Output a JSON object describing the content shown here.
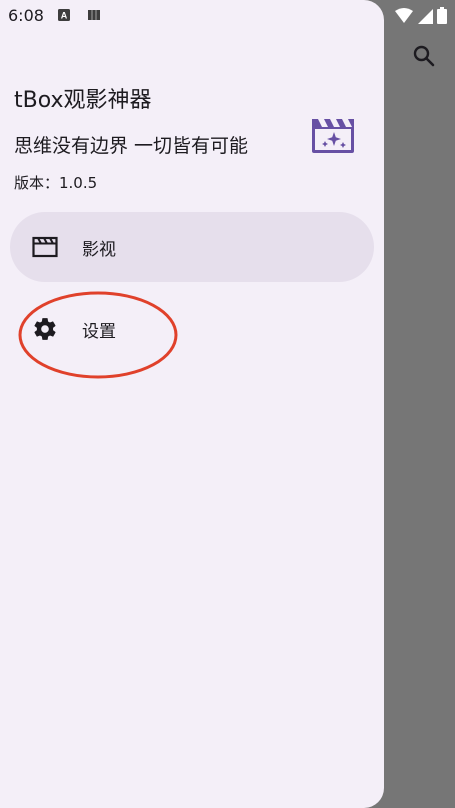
{
  "status_bar": {
    "time": "6:08",
    "icons": [
      "a-notification-icon",
      "storage-notification-icon"
    ],
    "right_icons": [
      "wifi-icon",
      "cell-signal-icon",
      "battery-icon"
    ]
  },
  "app": {
    "title": "tBox观影神器",
    "slogan": "思维没有边界 一切皆有可能",
    "version": "版本：1.0.5",
    "header_icon": "movie-sparkle-icon"
  },
  "nav": {
    "items": [
      {
        "label": "影视",
        "icon": "movie-icon",
        "selected": true
      },
      {
        "label": "设置",
        "icon": "gear-icon",
        "selected": false
      }
    ]
  },
  "toolbar": {
    "search_icon": "search-icon"
  },
  "colors": {
    "drawer_bg": "#f4eff8",
    "selected_bg": "#e6dfec",
    "scrim": "#767676",
    "accent": "#6750a4",
    "annotation": "#e0412b"
  }
}
